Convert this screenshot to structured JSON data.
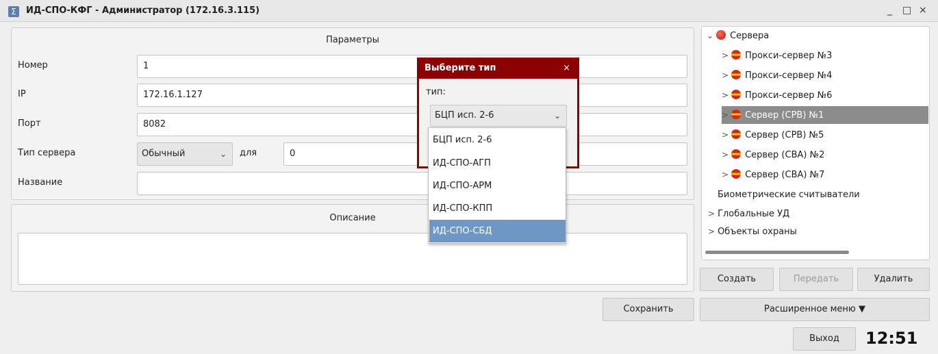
{
  "window": {
    "title": "ИД-СПО-КФГ - Администратор  (172.16.3.115)",
    "app_icon": "Σ",
    "controls": {
      "minimize": "_",
      "maximize": "□",
      "close": "×"
    }
  },
  "params": {
    "caption": "Параметры",
    "number_label": "Номер",
    "number_value": "1",
    "ip_label": "IP",
    "ip_value": "172.16.1.127",
    "port_label": "Порт",
    "port_value": "8082",
    "server_type_label": "Тип сервера",
    "server_type_value": "Обычный",
    "for_label": "для",
    "for_value": "0",
    "name_label": "Название",
    "name_value": ""
  },
  "description": {
    "caption": "Описание",
    "value": ""
  },
  "save_button": "Сохранить",
  "tree": {
    "root": "Сервера",
    "servers": [
      "Прокси-сервер №3",
      "Прокси-сервер №4",
      "Прокси-сервер №6",
      "Сервер (СРВ) №1",
      "Сервер (СРВ) №5",
      "Сервер (СВА) №2",
      "Сервер (СВА) №7"
    ],
    "biometric": "Биометрические считыватели",
    "global_ud": "Глобальные УД",
    "objects": "Объекты охраны"
  },
  "buttons": {
    "create": "Создать",
    "transfer": "Передать",
    "delete": "Удалить",
    "extended_menu": "Расширенное меню ▼",
    "exit": "Выход"
  },
  "clock": "12:51",
  "dialog": {
    "title": "Выберите тип",
    "close": "×",
    "type_label": "тип:",
    "selected": "БЦП исп. 2-6",
    "options": [
      "БЦП исп. 2-6",
      "ИД-СПО-АГП",
      "ИД-СПО-АРМ",
      "ИД-СПО-КПП",
      "ИД-СПО-СБД"
    ]
  },
  "colors": {
    "dialog_accent": "#8b0000",
    "selection": "#6f97c6",
    "tree_selected": "#8c8c8c"
  }
}
